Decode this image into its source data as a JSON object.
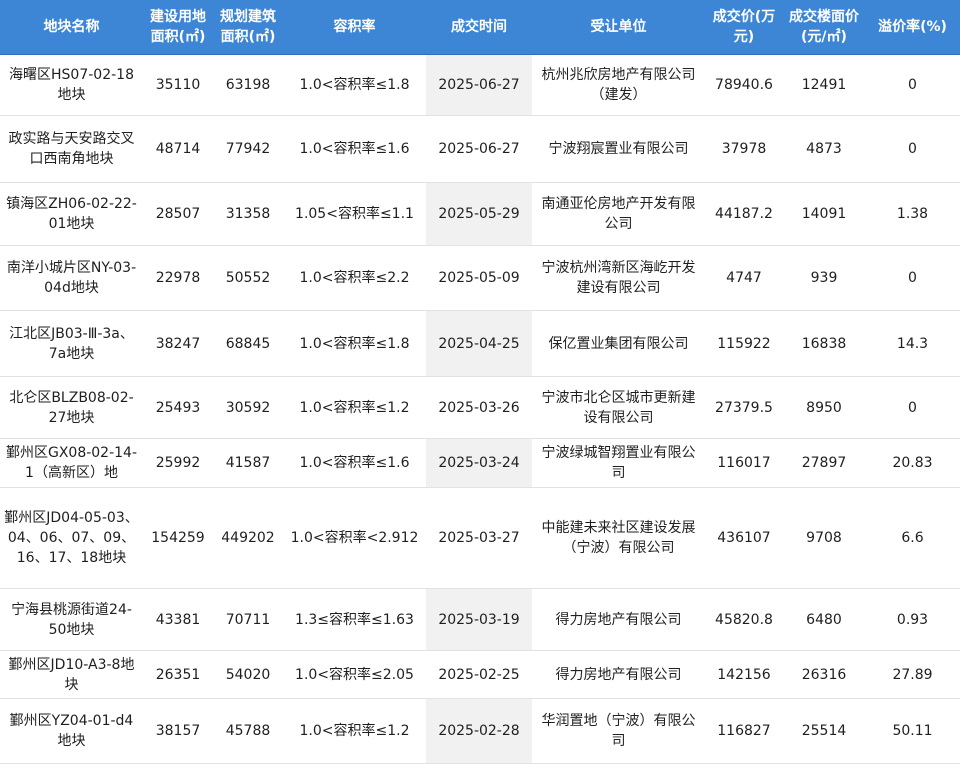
{
  "table": {
    "headers": [
      "地块名称",
      "建设用地面积(㎡)",
      "规划建筑面积(㎡)",
      "容积率",
      "成交时间",
      "受让单位",
      "成交价(万元)",
      "成交楼面价(元/㎡)",
      "溢价率(%)"
    ],
    "rows": [
      {
        "name": "海曙区HS07-02-18地块",
        "land_area": "35110",
        "build_area": "63198",
        "far": "1.0<容积率≤1.8",
        "date": "2025-06-27",
        "buyer": "杭州兆欣房地产有限公司（建发）",
        "price": "78940.6",
        "floor_price": "12491",
        "premium": "0"
      },
      {
        "name": "政实路与天安路交叉口西南角地块",
        "land_area": "48714",
        "build_area": "77942",
        "far": "1.0<容积率≤1.6",
        "date": "2025-06-27",
        "buyer": "宁波翔宸置业有限公司",
        "price": "37978",
        "floor_price": "4873",
        "premium": "0"
      },
      {
        "name": "镇海区ZH06-02-22-01地块",
        "land_area": "28507",
        "build_area": "31358",
        "far": "1.05<容积率≤1.1",
        "date": "2025-05-29",
        "buyer": "南通亚伦房地产开发有限公司",
        "price": "44187.2",
        "floor_price": "14091",
        "premium": "1.38"
      },
      {
        "name": "南洋小城片区NY-03-04d地块",
        "land_area": "22978",
        "build_area": "50552",
        "far": "1.0<容积率≤2.2",
        "date": "2025-05-09",
        "buyer": "宁波杭州湾新区海屹开发建设有限公司",
        "price": "4747",
        "floor_price": "939",
        "premium": "0"
      },
      {
        "name": "江北区JB03-Ⅲ-3a、7a地块",
        "land_area": "38247",
        "build_area": "68845",
        "far": "1.0<容积率≤1.8",
        "date": "2025-04-25",
        "buyer": "保亿置业集团有限公司",
        "price": "115922",
        "floor_price": "16838",
        "premium": "14.3"
      },
      {
        "name": "北仑区BLZB08-02-27地块",
        "land_area": "25493",
        "build_area": "30592",
        "far": "1.0<容积率≤1.2",
        "date": "2025-03-26",
        "buyer": "宁波市北仑区城市更新建设有限公司",
        "price": "27379.5",
        "floor_price": "8950",
        "premium": "0"
      },
      {
        "name": "鄞州区GX08-02-14-1（高新区）地",
        "land_area": "25992",
        "build_area": "41587",
        "far": "1.0<容积率≤1.6",
        "date": "2025-03-24",
        "buyer": "宁波绿城智翔置业有限公司",
        "price": "116017",
        "floor_price": "27897",
        "premium": "20.83"
      },
      {
        "name": "鄞州区JD04-05-03、04、06、07、09、16、17、18地块",
        "land_area": "154259",
        "build_area": "449202",
        "far": "1.0<容积率<2.912",
        "date": "2025-03-27",
        "buyer": "中能建未来社区建设发展（宁波）有限公司",
        "price": "436107",
        "floor_price": "9708",
        "premium": "6.6"
      },
      {
        "name": "宁海县桃源街道24-50地块",
        "land_area": "43381",
        "build_area": "70711",
        "far": "1.3≤容积率≤1.63",
        "date": "2025-03-19",
        "buyer": "得力房地产有限公司",
        "price": "45820.8",
        "floor_price": "6480",
        "premium": "0.93"
      },
      {
        "name": "鄞州区JD10-A3-8地块",
        "land_area": "26351",
        "build_area": "54020",
        "far": "1.0<容积率≤2.05",
        "date": "2025-02-25",
        "buyer": "得力房地产有限公司",
        "price": "142156",
        "floor_price": "26316",
        "premium": "27.89"
      },
      {
        "name": "鄞州区YZ04-01-d4地块",
        "land_area": "38157",
        "build_area": "45788",
        "far": "1.0<容积率≤1.2",
        "date": "2025-02-28",
        "buyer": "华润置地（宁波）有限公司",
        "price": "116827",
        "floor_price": "25514",
        "premium": "50.11"
      }
    ]
  }
}
